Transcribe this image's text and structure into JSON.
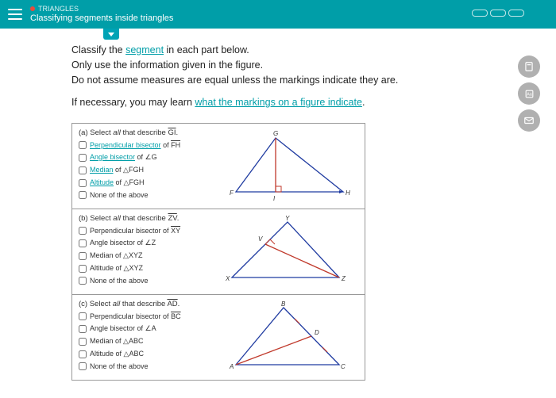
{
  "header": {
    "category": "TRIANGLES",
    "title": "Classifying segments inside triangles"
  },
  "instructions": {
    "line1_a": "Classify the ",
    "line1_link": "segment",
    "line1_b": " in each part below.",
    "line2": "Only use the information given in the figure.",
    "line3": "Do not assume measures are equal unless the markings indicate they are.",
    "line4_a": "If necessary, you may learn ",
    "line4_link": "what the markings on a figure indicate",
    "line4_b": "."
  },
  "parts": [
    {
      "id": "a",
      "prompt_prefix": "(a)  Select all that describe ",
      "seg_label": "GI",
      "options": [
        {
          "text_a": "Perpendicular bisector",
          "link": true,
          "text_b": " of ",
          "seg": "FH"
        },
        {
          "text_a": "Angle bisector",
          "link": true,
          "text_b": " of ∠G",
          "seg": ""
        },
        {
          "text_a": "Median",
          "link": true,
          "text_b": " of △FGH",
          "seg": ""
        },
        {
          "text_a": "Altitude",
          "link": true,
          "text_b": " of △FGH",
          "seg": ""
        },
        {
          "text_a": "None of the above",
          "link": false,
          "text_b": "",
          "seg": ""
        }
      ],
      "figure": {
        "type": "a",
        "labels": {
          "top": "G",
          "left": "F",
          "right": "H",
          "foot": "I"
        }
      }
    },
    {
      "id": "b",
      "prompt_prefix": "(b)  Select all that describe ",
      "seg_label": "ZV",
      "options": [
        {
          "text_a": "Perpendicular bisector",
          "link": false,
          "text_b": " of ",
          "seg": "XY"
        },
        {
          "text_a": "Angle bisector",
          "link": false,
          "text_b": " of ∠Z",
          "seg": ""
        },
        {
          "text_a": "Median of △XYZ",
          "link": false,
          "text_b": "",
          "seg": ""
        },
        {
          "text_a": "Altitude of △XYZ",
          "link": false,
          "text_b": "",
          "seg": ""
        },
        {
          "text_a": "None of the above",
          "link": false,
          "text_b": "",
          "seg": ""
        }
      ],
      "figure": {
        "type": "b",
        "labels": {
          "top": "Y",
          "left": "X",
          "right": "Z",
          "foot": "V"
        }
      }
    },
    {
      "id": "c",
      "prompt_prefix": "(c)  Select all that describe ",
      "seg_label": "AD",
      "options": [
        {
          "text_a": "Perpendicular bisector",
          "link": false,
          "text_b": " of ",
          "seg": "BC"
        },
        {
          "text_a": "Angle bisector",
          "link": false,
          "text_b": " of ∠A",
          "seg": ""
        },
        {
          "text_a": "Median of △ABC",
          "link": false,
          "text_b": "",
          "seg": ""
        },
        {
          "text_a": "Altitude of △ABC",
          "link": false,
          "text_b": "",
          "seg": ""
        },
        {
          "text_a": "None of the above",
          "link": false,
          "text_b": "",
          "seg": ""
        }
      ],
      "figure": {
        "type": "c",
        "labels": {
          "top": "B",
          "left": "A",
          "right": "C",
          "mid": "D"
        }
      }
    }
  ]
}
